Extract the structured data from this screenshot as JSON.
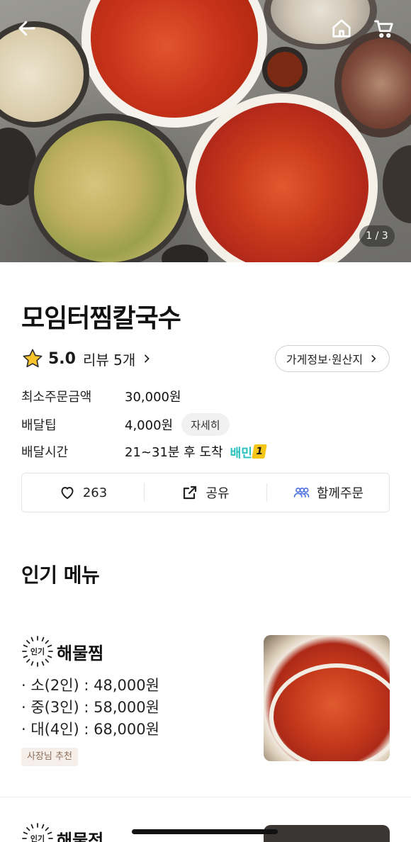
{
  "hero": {
    "pager": "1 / 3",
    "back_icon": "arrow-left-icon",
    "home_icon": "home-icon",
    "cart_icon": "cart-icon"
  },
  "store": {
    "name": "모임터찜칼국수",
    "rating": "5.0",
    "review_label": "리뷰 5개",
    "info_button": "가게정보·원산지"
  },
  "meta": {
    "min_order_label": "최소주문금액",
    "min_order_value": "30,000원",
    "tip_label": "배달팁",
    "tip_value": "4,000원",
    "tip_detail": "자세히",
    "time_label": "배달시간",
    "time_value": "21~31분 후 도착",
    "badge_text": "배민",
    "badge_num": "1"
  },
  "actions": {
    "like_count": "263",
    "share_label": "공유",
    "group_label": "함께주문"
  },
  "section": {
    "title": "인기 메뉴"
  },
  "menu": [
    {
      "badge": "인기",
      "name": "해물찜",
      "prices": [
        "· 소(2인) : 48,000원",
        "· 중(3인) : 58,000원",
        "· 대(4인) : 68,000원"
      ],
      "tag": "사장님 추천"
    },
    {
      "badge": "인기",
      "name": "해물전"
    }
  ],
  "colors": {
    "accent_mint": "#2ac1bc",
    "group_icon": "#4a6fe3",
    "tag_bg": "#f6efe9",
    "tag_text": "#8a6d5a"
  }
}
